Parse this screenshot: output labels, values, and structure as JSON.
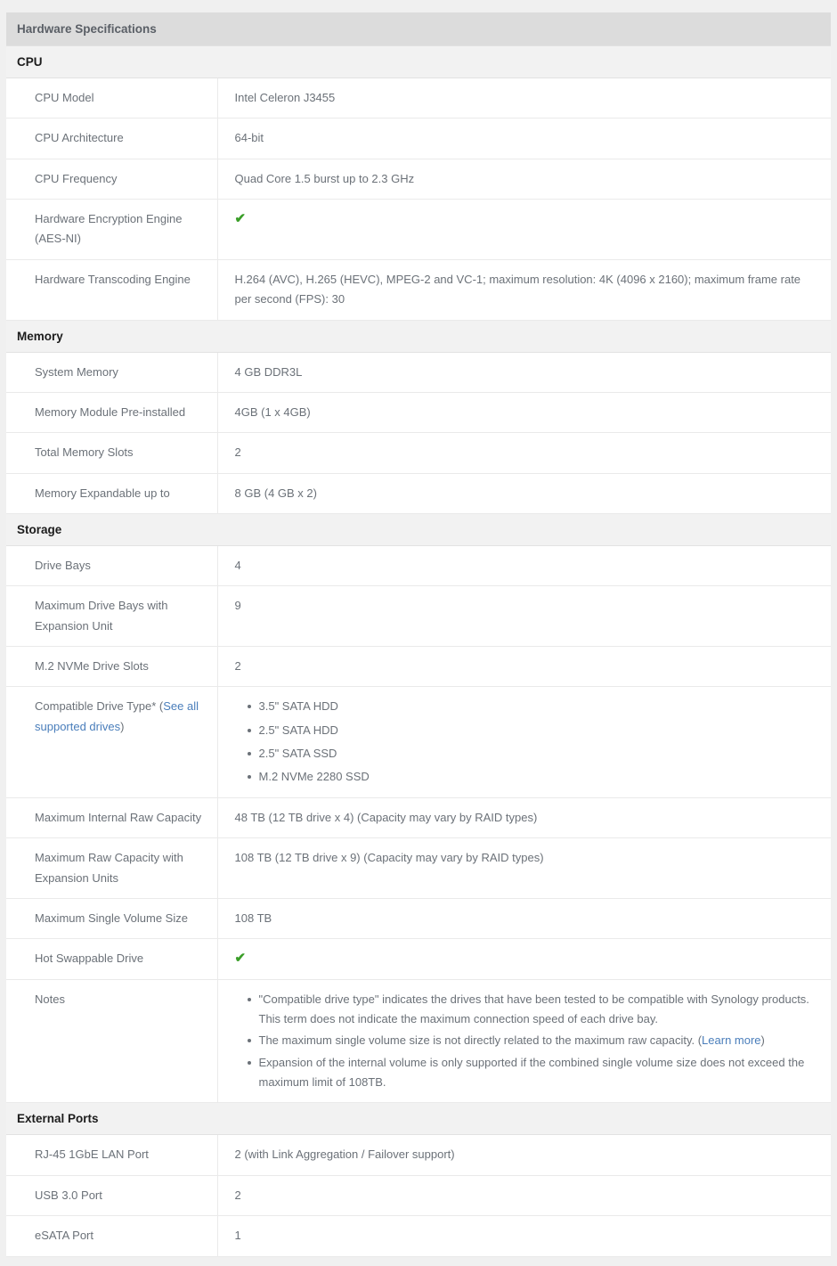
{
  "header": {
    "title": "Hardware Specifications"
  },
  "icons": {
    "check": "✔"
  },
  "colors": {
    "link": "#4a7ebb",
    "check": "#3a9e28",
    "header_bg": "#dcdcdc",
    "section_bg": "#f2f2f2"
  },
  "sections": [
    {
      "title": "CPU",
      "rows": [
        {
          "label": "CPU Model",
          "value": "Intel Celeron J3455"
        },
        {
          "label": "CPU Architecture",
          "value": "64-bit"
        },
        {
          "label": "CPU Frequency",
          "value": "Quad Core 1.5 burst up to 2.3 GHz"
        },
        {
          "label": "Hardware Encryption Engine (AES-NI)",
          "value": ""
        },
        {
          "label": "Hardware Transcoding Engine",
          "value": "H.264 (AVC), H.265 (HEVC), MPEG-2 and VC-1; maximum resolution: 4K (4096 x 2160); maximum frame rate per second (FPS): 30"
        }
      ]
    },
    {
      "title": "Memory",
      "rows": [
        {
          "label": "System Memory",
          "value": "4 GB DDR3L"
        },
        {
          "label": "Memory Module Pre-installed",
          "value": "4GB (1 x 4GB)"
        },
        {
          "label": "Total Memory Slots",
          "value": "2"
        },
        {
          "label": "Memory Expandable up to",
          "value": "8 GB (4 GB x 2)"
        }
      ]
    },
    {
      "title": "Storage",
      "rows": [
        {
          "label": "Drive Bays",
          "value": "4"
        },
        {
          "label": "Maximum Drive Bays with Expansion Unit",
          "value": "9"
        },
        {
          "label": "M.2 NVMe Drive Slots",
          "value": "2"
        },
        {
          "label_prefix": "Compatible Drive Type* (",
          "label_link": "See all supported drives",
          "label_suffix": ")",
          "list": [
            "3.5\" SATA HDD",
            "2.5\" SATA HDD",
            "2.5\" SATA SSD",
            "M.2 NVMe 2280 SSD"
          ]
        },
        {
          "label": "Maximum Internal Raw Capacity",
          "value": "48 TB (12 TB drive x 4) (Capacity may vary by RAID types)"
        },
        {
          "label": "Maximum Raw Capacity with Expansion Units",
          "value": "108 TB (12 TB drive x 9) (Capacity may vary by RAID types)"
        },
        {
          "label": "Maximum Single Volume Size",
          "value": "108 TB"
        },
        {
          "label": "Hot Swappable Drive",
          "value": ""
        }
      ],
      "notes": {
        "label": "Notes",
        "items": [
          {
            "text": "\"Compatible drive type\" indicates the drives that have been tested to be compatible with Synology products. This term does not indicate the maximum connection speed of each drive bay."
          },
          {
            "text": "The maximum single volume size is not directly related to the maximum raw capacity. (",
            "link": "Learn more",
            "suffix": ")"
          },
          {
            "text": "Expansion of the internal volume is only supported if the combined single volume size does not exceed the maximum limit of 108TB."
          }
        ]
      }
    },
    {
      "title": "External Ports",
      "rows": [
        {
          "label": "RJ-45 1GbE LAN Port",
          "value": "2 (with Link Aggregation / Failover support)"
        },
        {
          "label": "USB 3.0 Port",
          "value": "2"
        },
        {
          "label": "eSATA Port",
          "value": "1"
        }
      ]
    }
  ]
}
